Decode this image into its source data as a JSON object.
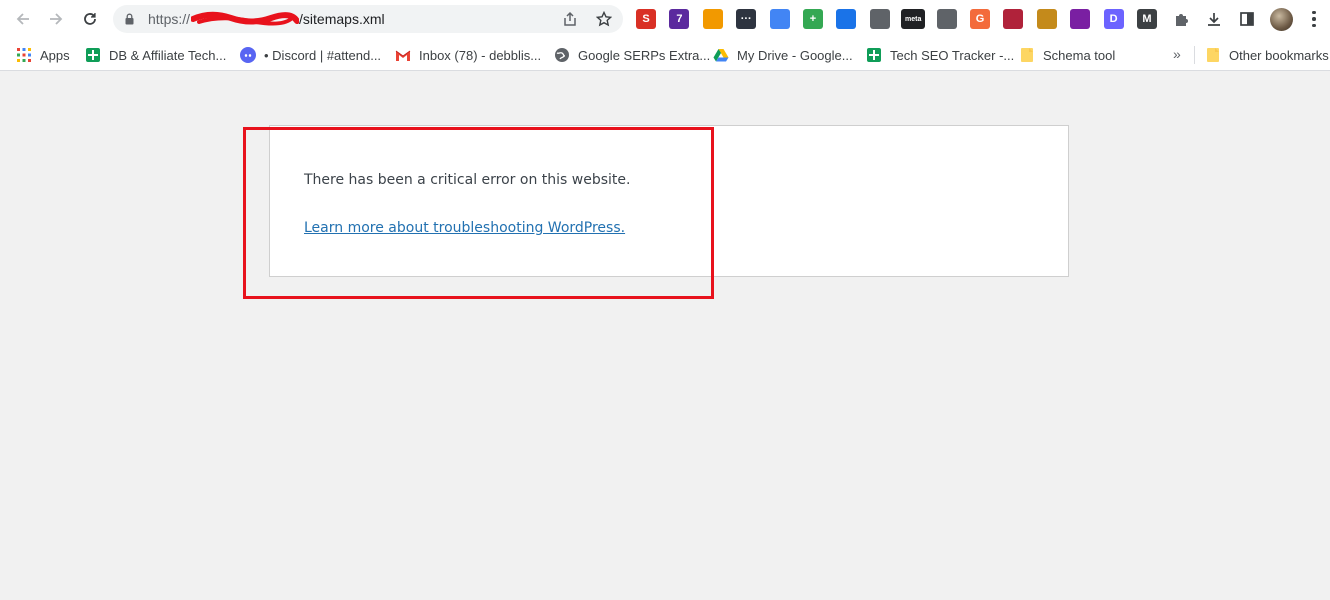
{
  "toolbar": {
    "url_scheme": "https://",
    "url_path": "/sitemaps.xml",
    "icons": [
      "back-arrow-icon",
      "forward-arrow-icon",
      "reload-icon",
      "lock-icon",
      "share-icon",
      "star-icon"
    ],
    "extensions": [
      {
        "name": "seo-extension-icon",
        "color": "#d93025",
        "label": "S"
      },
      {
        "name": "purple-extension-icon",
        "color": "#5b2a9e",
        "label": "7"
      },
      {
        "name": "orange-extension-icon",
        "color": "#f29900",
        "label": ""
      },
      {
        "name": "dots-extension-icon",
        "color": "#2e3440",
        "label": "···"
      },
      {
        "name": "blue-extension-icon",
        "color": "#4285f4",
        "label": ""
      },
      {
        "name": "plus-extension-icon",
        "color": "#34a853",
        "label": "+"
      },
      {
        "name": "record-extension-icon",
        "color": "#1a73e8",
        "label": ""
      },
      {
        "name": "link-extension-icon",
        "color": "#5f6368",
        "label": ""
      },
      {
        "name": "meta-extension-icon",
        "color": "#202124",
        "label": "meta"
      },
      {
        "name": "gear-extension-icon",
        "color": "#5f6368",
        "label": ""
      },
      {
        "name": "g-extension-icon",
        "color": "#f36b3b",
        "label": "G"
      },
      {
        "name": "flower-extension-icon",
        "color": "#b0223a",
        "label": ""
      },
      {
        "name": "magnifier-extension-icon",
        "color": "#c48a1b",
        "label": ""
      },
      {
        "name": "ladybug-extension-icon",
        "color": "#7a1fa2",
        "label": ""
      },
      {
        "name": "d-extension-icon",
        "color": "#6c63ff",
        "label": "D"
      },
      {
        "name": "m-extension-icon",
        "color": "#3c4043",
        "label": "M"
      }
    ]
  },
  "bookmarks": {
    "items": [
      {
        "label": "Apps",
        "icon": "apps-grid-icon"
      },
      {
        "label": "DB & Affiliate Tech...",
        "icon": "sheets-icon"
      },
      {
        "label": "• Discord | #attend...",
        "icon": "discord-icon"
      },
      {
        "label": "Inbox (78) - debblis...",
        "icon": "gmail-icon"
      },
      {
        "label": "Google SERPs Extra...",
        "icon": "globe-icon"
      },
      {
        "label": "My Drive - Google...",
        "icon": "drive-icon"
      },
      {
        "label": "Tech SEO Tracker -...",
        "icon": "sheets-icon"
      },
      {
        "label": "Schema tool",
        "icon": "folder-icon"
      }
    ],
    "overflow_label": "»",
    "other_label": "Other bookmarks"
  },
  "page": {
    "error_message": "There has been a critical error on this website.",
    "link_text": "Learn more about troubleshooting WordPress."
  },
  "colors": {
    "link": "#2271b1",
    "annotation": "#e8121c",
    "page_background": "#f1f1f1"
  }
}
